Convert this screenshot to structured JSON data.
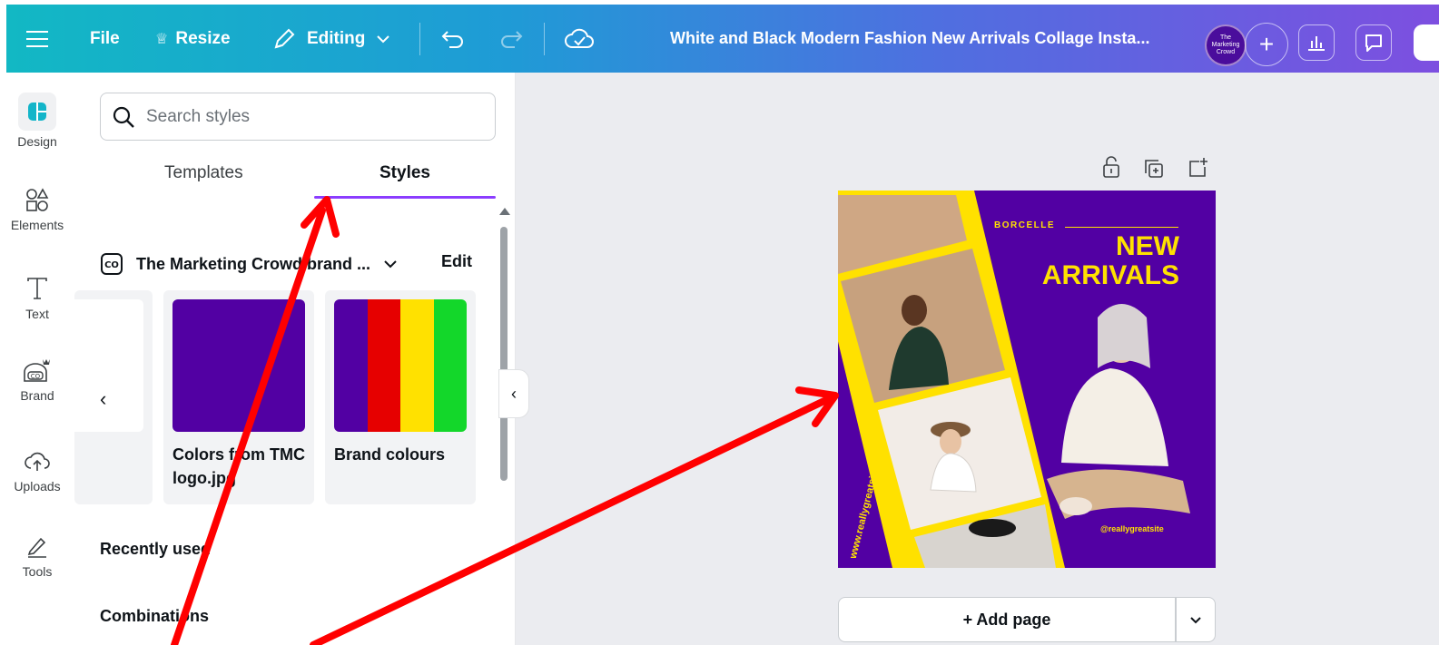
{
  "topbar": {
    "file_label": "File",
    "resize_label": "Resize",
    "editing_label": "Editing",
    "title": "White and Black Modern Fashion New Arrivals Collage Insta...",
    "avatar_text": "The Marketing Crowd"
  },
  "rail": {
    "items": [
      {
        "label": "Design"
      },
      {
        "label": "Elements"
      },
      {
        "label": "Text"
      },
      {
        "label": "Brand"
      },
      {
        "label": "Uploads"
      },
      {
        "label": "Tools"
      }
    ]
  },
  "panel": {
    "search_placeholder": "Search styles",
    "tabs": [
      {
        "label": "Templates"
      },
      {
        "label": "Styles"
      }
    ],
    "brand_kit_name": "The Marketing Crowd brand ...",
    "edit_label": "Edit",
    "cards": [
      {
        "label": "Colors from TMC logo.jpg",
        "swatches": [
          "#5200a3"
        ]
      },
      {
        "label": "Brand colours",
        "swatches": [
          "#5200a3",
          "#e60000",
          "#ffe100",
          "#13d72a"
        ]
      }
    ],
    "sections": [
      "Recently used",
      "Combinations"
    ]
  },
  "design": {
    "brand": "BORCELLE",
    "headline_line1": "NEW",
    "headline_line2": "ARRIVALS",
    "website": "www.reallygreatsite.com",
    "handle": "@reallygreatsite",
    "colors": {
      "background": "#5200a3",
      "accent": "#ffe100"
    }
  },
  "canvas": {
    "add_page_label": "+ Add page"
  },
  "colors": {
    "accent": "#8b3dff",
    "annotation_arrow": "#ff0000"
  }
}
